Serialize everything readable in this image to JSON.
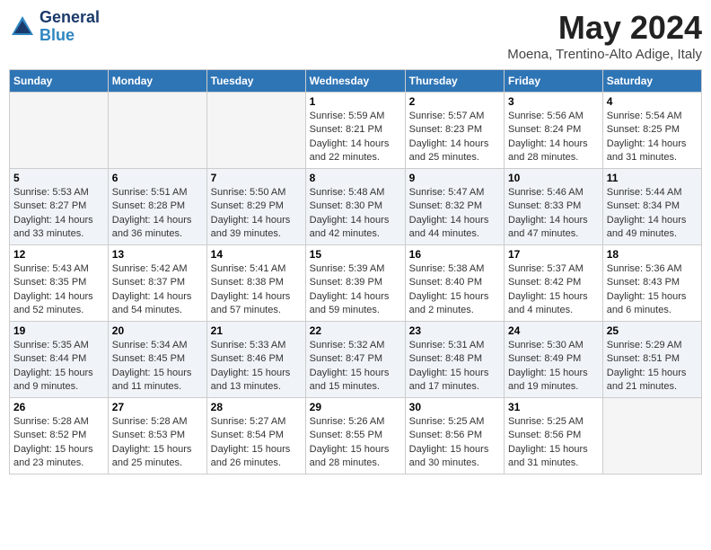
{
  "logo": {
    "line1": "General",
    "line2": "Blue"
  },
  "title": "May 2024",
  "location": "Moena, Trentino-Alto Adige, Italy",
  "weekdays": [
    "Sunday",
    "Monday",
    "Tuesday",
    "Wednesday",
    "Thursday",
    "Friday",
    "Saturday"
  ],
  "weeks": [
    [
      {
        "day": "",
        "info": []
      },
      {
        "day": "",
        "info": []
      },
      {
        "day": "",
        "info": []
      },
      {
        "day": "1",
        "info": [
          "Sunrise: 5:59 AM",
          "Sunset: 8:21 PM",
          "Daylight: 14 hours",
          "and 22 minutes."
        ]
      },
      {
        "day": "2",
        "info": [
          "Sunrise: 5:57 AM",
          "Sunset: 8:23 PM",
          "Daylight: 14 hours",
          "and 25 minutes."
        ]
      },
      {
        "day": "3",
        "info": [
          "Sunrise: 5:56 AM",
          "Sunset: 8:24 PM",
          "Daylight: 14 hours",
          "and 28 minutes."
        ]
      },
      {
        "day": "4",
        "info": [
          "Sunrise: 5:54 AM",
          "Sunset: 8:25 PM",
          "Daylight: 14 hours",
          "and 31 minutes."
        ]
      }
    ],
    [
      {
        "day": "5",
        "info": [
          "Sunrise: 5:53 AM",
          "Sunset: 8:27 PM",
          "Daylight: 14 hours",
          "and 33 minutes."
        ]
      },
      {
        "day": "6",
        "info": [
          "Sunrise: 5:51 AM",
          "Sunset: 8:28 PM",
          "Daylight: 14 hours",
          "and 36 minutes."
        ]
      },
      {
        "day": "7",
        "info": [
          "Sunrise: 5:50 AM",
          "Sunset: 8:29 PM",
          "Daylight: 14 hours",
          "and 39 minutes."
        ]
      },
      {
        "day": "8",
        "info": [
          "Sunrise: 5:48 AM",
          "Sunset: 8:30 PM",
          "Daylight: 14 hours",
          "and 42 minutes."
        ]
      },
      {
        "day": "9",
        "info": [
          "Sunrise: 5:47 AM",
          "Sunset: 8:32 PM",
          "Daylight: 14 hours",
          "and 44 minutes."
        ]
      },
      {
        "day": "10",
        "info": [
          "Sunrise: 5:46 AM",
          "Sunset: 8:33 PM",
          "Daylight: 14 hours",
          "and 47 minutes."
        ]
      },
      {
        "day": "11",
        "info": [
          "Sunrise: 5:44 AM",
          "Sunset: 8:34 PM",
          "Daylight: 14 hours",
          "and 49 minutes."
        ]
      }
    ],
    [
      {
        "day": "12",
        "info": [
          "Sunrise: 5:43 AM",
          "Sunset: 8:35 PM",
          "Daylight: 14 hours",
          "and 52 minutes."
        ]
      },
      {
        "day": "13",
        "info": [
          "Sunrise: 5:42 AM",
          "Sunset: 8:37 PM",
          "Daylight: 14 hours",
          "and 54 minutes."
        ]
      },
      {
        "day": "14",
        "info": [
          "Sunrise: 5:41 AM",
          "Sunset: 8:38 PM",
          "Daylight: 14 hours",
          "and 57 minutes."
        ]
      },
      {
        "day": "15",
        "info": [
          "Sunrise: 5:39 AM",
          "Sunset: 8:39 PM",
          "Daylight: 14 hours",
          "and 59 minutes."
        ]
      },
      {
        "day": "16",
        "info": [
          "Sunrise: 5:38 AM",
          "Sunset: 8:40 PM",
          "Daylight: 15 hours",
          "and 2 minutes."
        ]
      },
      {
        "day": "17",
        "info": [
          "Sunrise: 5:37 AM",
          "Sunset: 8:42 PM",
          "Daylight: 15 hours",
          "and 4 minutes."
        ]
      },
      {
        "day": "18",
        "info": [
          "Sunrise: 5:36 AM",
          "Sunset: 8:43 PM",
          "Daylight: 15 hours",
          "and 6 minutes."
        ]
      }
    ],
    [
      {
        "day": "19",
        "info": [
          "Sunrise: 5:35 AM",
          "Sunset: 8:44 PM",
          "Daylight: 15 hours",
          "and 9 minutes."
        ]
      },
      {
        "day": "20",
        "info": [
          "Sunrise: 5:34 AM",
          "Sunset: 8:45 PM",
          "Daylight: 15 hours",
          "and 11 minutes."
        ]
      },
      {
        "day": "21",
        "info": [
          "Sunrise: 5:33 AM",
          "Sunset: 8:46 PM",
          "Daylight: 15 hours",
          "and 13 minutes."
        ]
      },
      {
        "day": "22",
        "info": [
          "Sunrise: 5:32 AM",
          "Sunset: 8:47 PM",
          "Daylight: 15 hours",
          "and 15 minutes."
        ]
      },
      {
        "day": "23",
        "info": [
          "Sunrise: 5:31 AM",
          "Sunset: 8:48 PM",
          "Daylight: 15 hours",
          "and 17 minutes."
        ]
      },
      {
        "day": "24",
        "info": [
          "Sunrise: 5:30 AM",
          "Sunset: 8:49 PM",
          "Daylight: 15 hours",
          "and 19 minutes."
        ]
      },
      {
        "day": "25",
        "info": [
          "Sunrise: 5:29 AM",
          "Sunset: 8:51 PM",
          "Daylight: 15 hours",
          "and 21 minutes."
        ]
      }
    ],
    [
      {
        "day": "26",
        "info": [
          "Sunrise: 5:28 AM",
          "Sunset: 8:52 PM",
          "Daylight: 15 hours",
          "and 23 minutes."
        ]
      },
      {
        "day": "27",
        "info": [
          "Sunrise: 5:28 AM",
          "Sunset: 8:53 PM",
          "Daylight: 15 hours",
          "and 25 minutes."
        ]
      },
      {
        "day": "28",
        "info": [
          "Sunrise: 5:27 AM",
          "Sunset: 8:54 PM",
          "Daylight: 15 hours",
          "and 26 minutes."
        ]
      },
      {
        "day": "29",
        "info": [
          "Sunrise: 5:26 AM",
          "Sunset: 8:55 PM",
          "Daylight: 15 hours",
          "and 28 minutes."
        ]
      },
      {
        "day": "30",
        "info": [
          "Sunrise: 5:25 AM",
          "Sunset: 8:56 PM",
          "Daylight: 15 hours",
          "and 30 minutes."
        ]
      },
      {
        "day": "31",
        "info": [
          "Sunrise: 5:25 AM",
          "Sunset: 8:56 PM",
          "Daylight: 15 hours",
          "and 31 minutes."
        ]
      },
      {
        "day": "",
        "info": []
      }
    ]
  ]
}
